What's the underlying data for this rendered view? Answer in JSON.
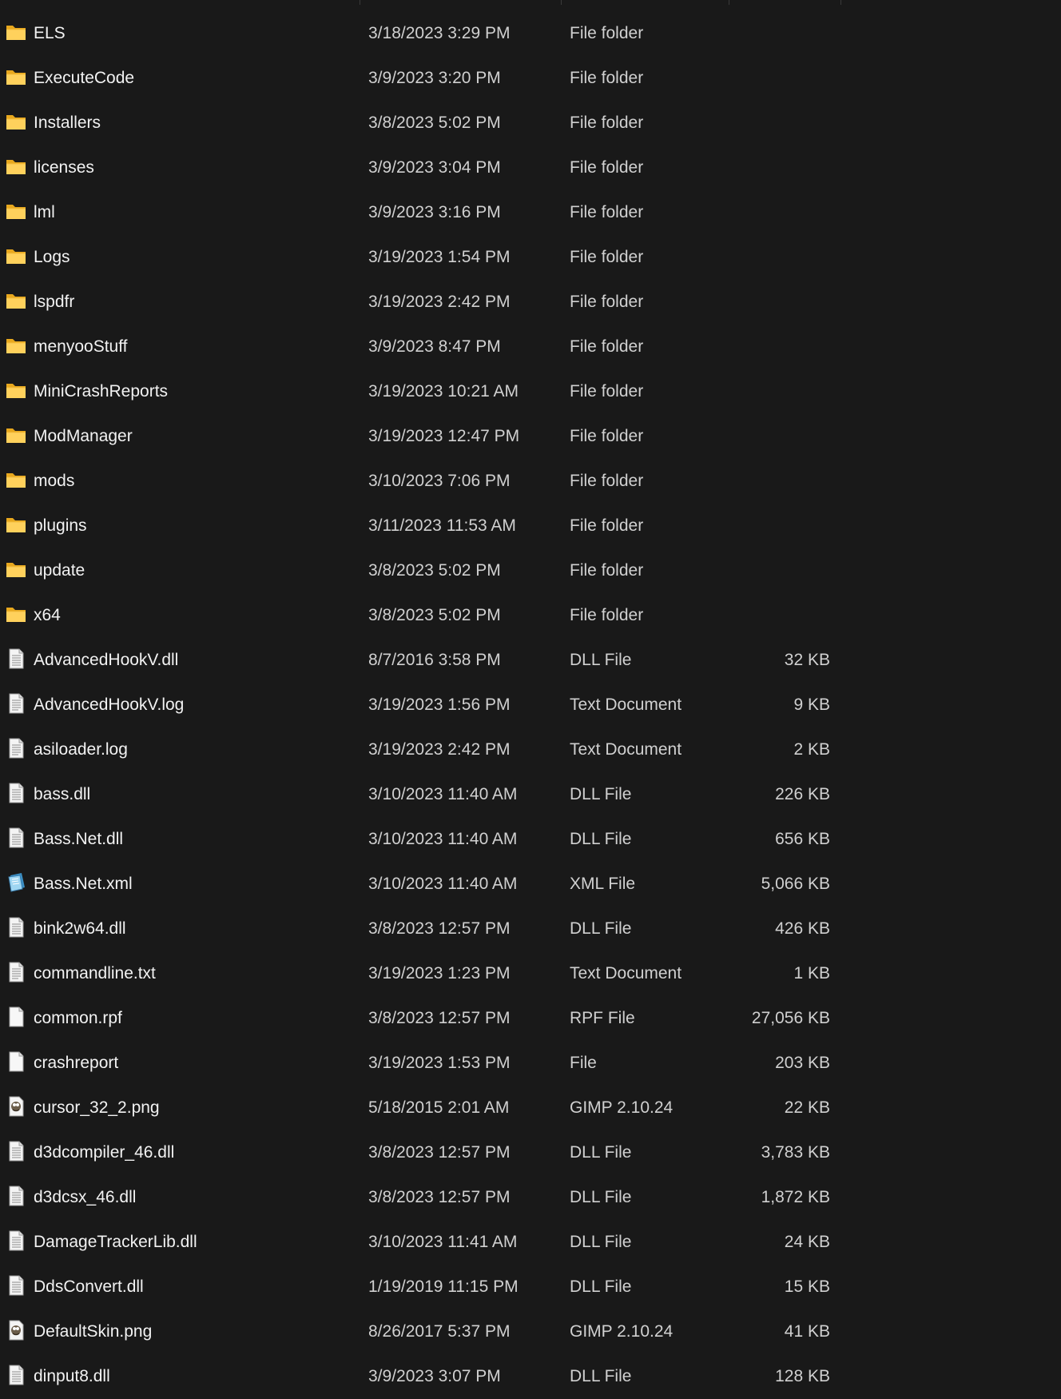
{
  "files": [
    {
      "name": "ELS",
      "date": "3/18/2023 3:29 PM",
      "type": "File folder",
      "size": "",
      "icon": "folder-icon"
    },
    {
      "name": "ExecuteCode",
      "date": "3/9/2023 3:20 PM",
      "type": "File folder",
      "size": "",
      "icon": "folder-icon"
    },
    {
      "name": "Installers",
      "date": "3/8/2023 5:02 PM",
      "type": "File folder",
      "size": "",
      "icon": "folder-icon"
    },
    {
      "name": "licenses",
      "date": "3/9/2023 3:04 PM",
      "type": "File folder",
      "size": "",
      "icon": "folder-icon"
    },
    {
      "name": "lml",
      "date": "3/9/2023 3:16 PM",
      "type": "File folder",
      "size": "",
      "icon": "folder-icon"
    },
    {
      "name": "Logs",
      "date": "3/19/2023 1:54 PM",
      "type": "File folder",
      "size": "",
      "icon": "folder-icon"
    },
    {
      "name": "lspdfr",
      "date": "3/19/2023 2:42 PM",
      "type": "File folder",
      "size": "",
      "icon": "folder-icon"
    },
    {
      "name": "menyooStuff",
      "date": "3/9/2023 8:47 PM",
      "type": "File folder",
      "size": "",
      "icon": "folder-icon"
    },
    {
      "name": "MiniCrashReports",
      "date": "3/19/2023 10:21 AM",
      "type": "File folder",
      "size": "",
      "icon": "folder-icon"
    },
    {
      "name": "ModManager",
      "date": "3/19/2023 12:47 PM",
      "type": "File folder",
      "size": "",
      "icon": "folder-icon"
    },
    {
      "name": "mods",
      "date": "3/10/2023 7:06 PM",
      "type": "File folder",
      "size": "",
      "icon": "folder-icon"
    },
    {
      "name": "plugins",
      "date": "3/11/2023 11:53 AM",
      "type": "File folder",
      "size": "",
      "icon": "folder-icon"
    },
    {
      "name": "update",
      "date": "3/8/2023 5:02 PM",
      "type": "File folder",
      "size": "",
      "icon": "folder-icon"
    },
    {
      "name": "x64",
      "date": "3/8/2023 5:02 PM",
      "type": "File folder",
      "size": "",
      "icon": "folder-icon"
    },
    {
      "name": "AdvancedHookV.dll",
      "date": "8/7/2016 3:58 PM",
      "type": "DLL File",
      "size": "32 KB",
      "icon": "dll-file-icon"
    },
    {
      "name": "AdvancedHookV.log",
      "date": "3/19/2023 1:56 PM",
      "type": "Text Document",
      "size": "9 KB",
      "icon": "text-file-icon"
    },
    {
      "name": "asiloader.log",
      "date": "3/19/2023 2:42 PM",
      "type": "Text Document",
      "size": "2 KB",
      "icon": "text-file-icon"
    },
    {
      "name": "bass.dll",
      "date": "3/10/2023 11:40 AM",
      "type": "DLL File",
      "size": "226 KB",
      "icon": "dll-file-icon"
    },
    {
      "name": "Bass.Net.dll",
      "date": "3/10/2023 11:40 AM",
      "type": "DLL File",
      "size": "656 KB",
      "icon": "dll-file-icon"
    },
    {
      "name": "Bass.Net.xml",
      "date": "3/10/2023 11:40 AM",
      "type": "XML File",
      "size": "5,066 KB",
      "icon": "xml-file-icon"
    },
    {
      "name": "bink2w64.dll",
      "date": "3/8/2023 12:57 PM",
      "type": "DLL File",
      "size": "426 KB",
      "icon": "dll-file-icon"
    },
    {
      "name": "commandline.txt",
      "date": "3/19/2023 1:23 PM",
      "type": "Text Document",
      "size": "1 KB",
      "icon": "text-file-icon"
    },
    {
      "name": "common.rpf",
      "date": "3/8/2023 12:57 PM",
      "type": "RPF File",
      "size": "27,056 KB",
      "icon": "blank-file-icon"
    },
    {
      "name": "crashreport",
      "date": "3/19/2023 1:53 PM",
      "type": "File",
      "size": "203 KB",
      "icon": "blank-file-icon"
    },
    {
      "name": "cursor_32_2.png",
      "date": "5/18/2015 2:01 AM",
      "type": "GIMP 2.10.24",
      "size": "22 KB",
      "icon": "gimp-image-icon"
    },
    {
      "name": "d3dcompiler_46.dll",
      "date": "3/8/2023 12:57 PM",
      "type": "DLL File",
      "size": "3,783 KB",
      "icon": "dll-file-icon"
    },
    {
      "name": "d3dcsx_46.dll",
      "date": "3/8/2023 12:57 PM",
      "type": "DLL File",
      "size": "1,872 KB",
      "icon": "dll-file-icon"
    },
    {
      "name": "DamageTrackerLib.dll",
      "date": "3/10/2023 11:41 AM",
      "type": "DLL File",
      "size": "24 KB",
      "icon": "dll-file-icon"
    },
    {
      "name": "DdsConvert.dll",
      "date": "1/19/2019 11:15 PM",
      "type": "DLL File",
      "size": "15 KB",
      "icon": "dll-file-icon"
    },
    {
      "name": "DefaultSkin.png",
      "date": "8/26/2017 5:37 PM",
      "type": "GIMP 2.10.24",
      "size": "41 KB",
      "icon": "gimp-image-icon"
    },
    {
      "name": "dinput8.dll",
      "date": "3/9/2023 3:07 PM",
      "type": "DLL File",
      "size": "128 KB",
      "icon": "dll-file-icon"
    }
  ]
}
